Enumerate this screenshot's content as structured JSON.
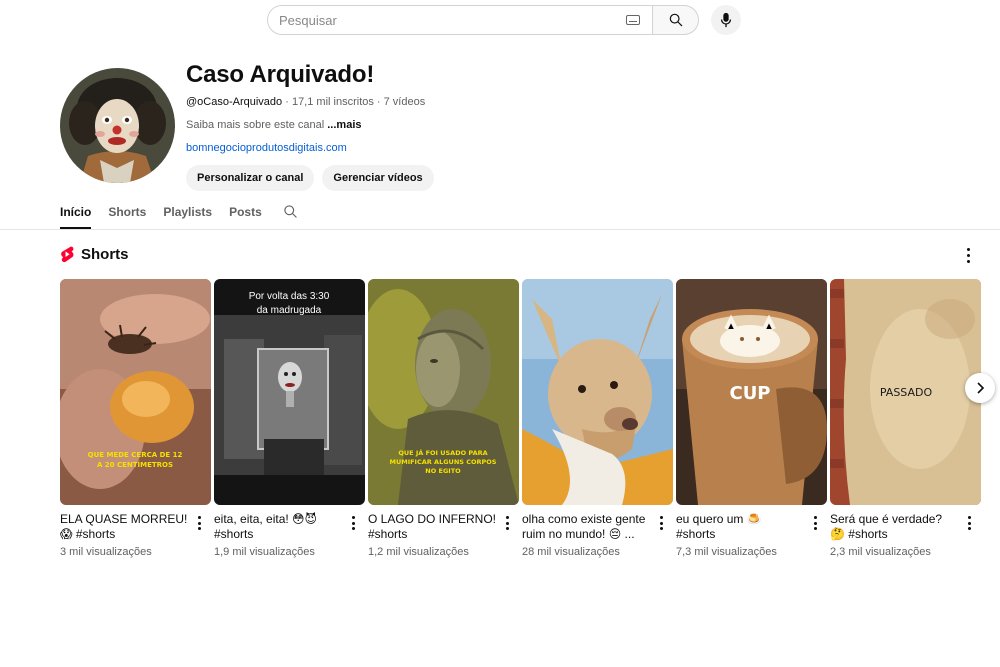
{
  "search": {
    "placeholder": "Pesquisar"
  },
  "channel": {
    "name": "Caso Arquivado!",
    "handle": "@oCaso-Arquivado",
    "stats": " · 17,1 mil inscritos · 7 vídeos",
    "about": "Saiba mais sobre este canal ",
    "about_more": "...mais",
    "link": "bomnegocioprodutosdigitais.com",
    "customize_label": "Personalizar o canal",
    "manage_label": "Gerenciar vídeos"
  },
  "tabs": [
    {
      "label": "Início",
      "active": true
    },
    {
      "label": "Shorts"
    },
    {
      "label": "Playlists"
    },
    {
      "label": "Posts"
    }
  ],
  "shorts": {
    "title": "Shorts",
    "items": [
      {
        "title": "ELA QUASE MORREU! 😱 #shorts",
        "views": "3 mil visualizações",
        "overlay": [
          "QUE MEDE CERCA DE 12",
          "A 20 CENTÍMETROS"
        ]
      },
      {
        "title": "eita, eita, eita! 😳😈 #shorts",
        "views": "1,9 mil visualizações",
        "overlay": [
          "Por volta das 3:30",
          "da madrugada"
        ]
      },
      {
        "title": "O LAGO DO INFERNO! #shorts",
        "views": "1,2 mil visualizações",
        "overlay": [
          "QUE JÁ FOI USADO PARA",
          "MUMIFICAR ALGUNS CORPOS",
          "NO EGITO"
        ]
      },
      {
        "title": "olha como existe gente ruim no mundo! 😔 ...",
        "views": "28 mil visualizações",
        "overlay": []
      },
      {
        "title": "eu quero um 🍮 #shorts",
        "views": "7,3 mil visualizações",
        "overlay": [
          "CUP"
        ]
      },
      {
        "title": "Será que é verdade? 🤔 #shorts",
        "views": "2,3 mil visualizações",
        "overlay": [
          "PASSADO"
        ]
      }
    ]
  },
  "colors": {
    "accent_red": "#ff0033",
    "link_blue": "#065fd4"
  }
}
